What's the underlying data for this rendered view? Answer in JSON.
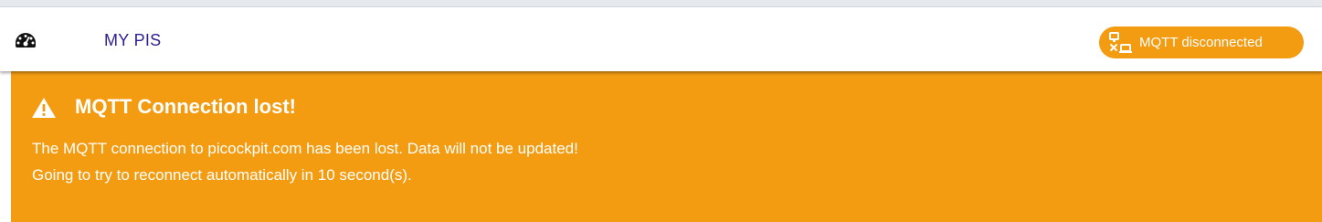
{
  "navbar": {
    "dashboard_icon": "dashboard-gauge-icon",
    "title": "MY PIS",
    "title_color": "#2b1f8f",
    "status": {
      "icon": "network-disconnected-icon",
      "label": "MQTT disconnected",
      "color": "#f39c12"
    }
  },
  "alert": {
    "icon": "warning-triangle-icon",
    "title": "MQTT Connection lost!",
    "line1": "The MQTT connection to picockpit.com has been lost. Data will not be updated!",
    "line2": "Going to try to reconnect automatically in 10 second(s).",
    "background": "#f39c12"
  }
}
